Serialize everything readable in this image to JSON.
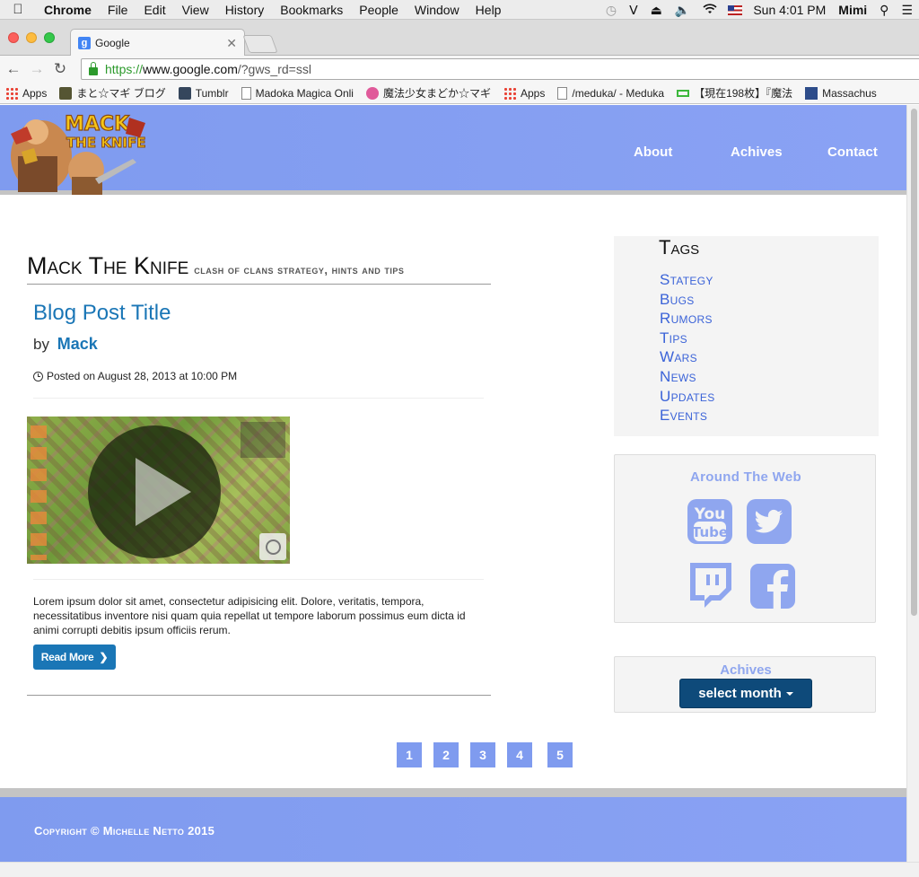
{
  "menubar": {
    "app_name": "Chrome",
    "items": [
      "File",
      "Edit",
      "View",
      "History",
      "Bookmarks",
      "People",
      "Window",
      "Help"
    ],
    "clock": "Sun 4:01 PM",
    "user": "Mimi"
  },
  "tab": {
    "favicon": "g",
    "title": "Google"
  },
  "omnibox": {
    "scheme": "https://",
    "host": "www.google.com",
    "path": "/?gws_rd=ssl"
  },
  "bookmarks": [
    {
      "label": "Apps",
      "icon": "apps-grid-icon"
    },
    {
      "label": "まと☆マギ ブログ",
      "icon": "blog-icon"
    },
    {
      "label": "Tumblr",
      "icon": "tumblr-icon"
    },
    {
      "label": "Madoka Magica Onli",
      "icon": "page-icon"
    },
    {
      "label": "魔法少女まどか☆マギ",
      "icon": "flower-icon"
    },
    {
      "label": "Apps",
      "icon": "apps-grid-icon"
    },
    {
      "label": "/meduka/ - Meduka",
      "icon": "page-icon"
    },
    {
      "label": "【現在198枚】『魔法",
      "icon": "green-box-icon"
    },
    {
      "label": "Massachus",
      "icon": "blue-box-icon"
    }
  ],
  "site": {
    "logo_alt": "Mack the Knife",
    "nav": [
      "About",
      "Achives",
      "Contact"
    ],
    "title": "Mack The Knife",
    "tagline": "clash of clans strategy, hints and tips"
  },
  "post": {
    "title": "Blog Post Title",
    "by": "by",
    "author": "Mack",
    "posted": "Posted on August 28, 2013 at 10:00 PM",
    "excerpt": "Lorem ipsum dolor sit amet, consectetur adipisicing elit. Dolore, veritatis, tempora, necessitatibus inventore nisi quam quia repellat ut tempore laborum possimus eum dicta id animi corrupti debitis ipsum officiis rerum.",
    "read_more": "Read More"
  },
  "sidebar": {
    "tags_title": "Tags",
    "tags": [
      "Stategy",
      "Bugs",
      "Rumors",
      "Tips",
      "Wars",
      "News",
      "Updates",
      "Events"
    ],
    "web_title": "Around The Web",
    "social": [
      "youtube-icon",
      "twitter-icon",
      "twitch-icon",
      "facebook-icon"
    ],
    "archive_title": "Achives",
    "archive_select": "select month"
  },
  "pagination": [
    "1",
    "2",
    "3",
    "4",
    "5"
  ],
  "footer": {
    "copyright": "Copyright © Michelle Netto 2015"
  },
  "colors": {
    "header_blue": "#7f9bef",
    "link_blue": "#1a76b6",
    "tag_blue": "#3b63d8",
    "social_blue": "#8fa6ef",
    "select_dark": "#0e4a7a"
  }
}
